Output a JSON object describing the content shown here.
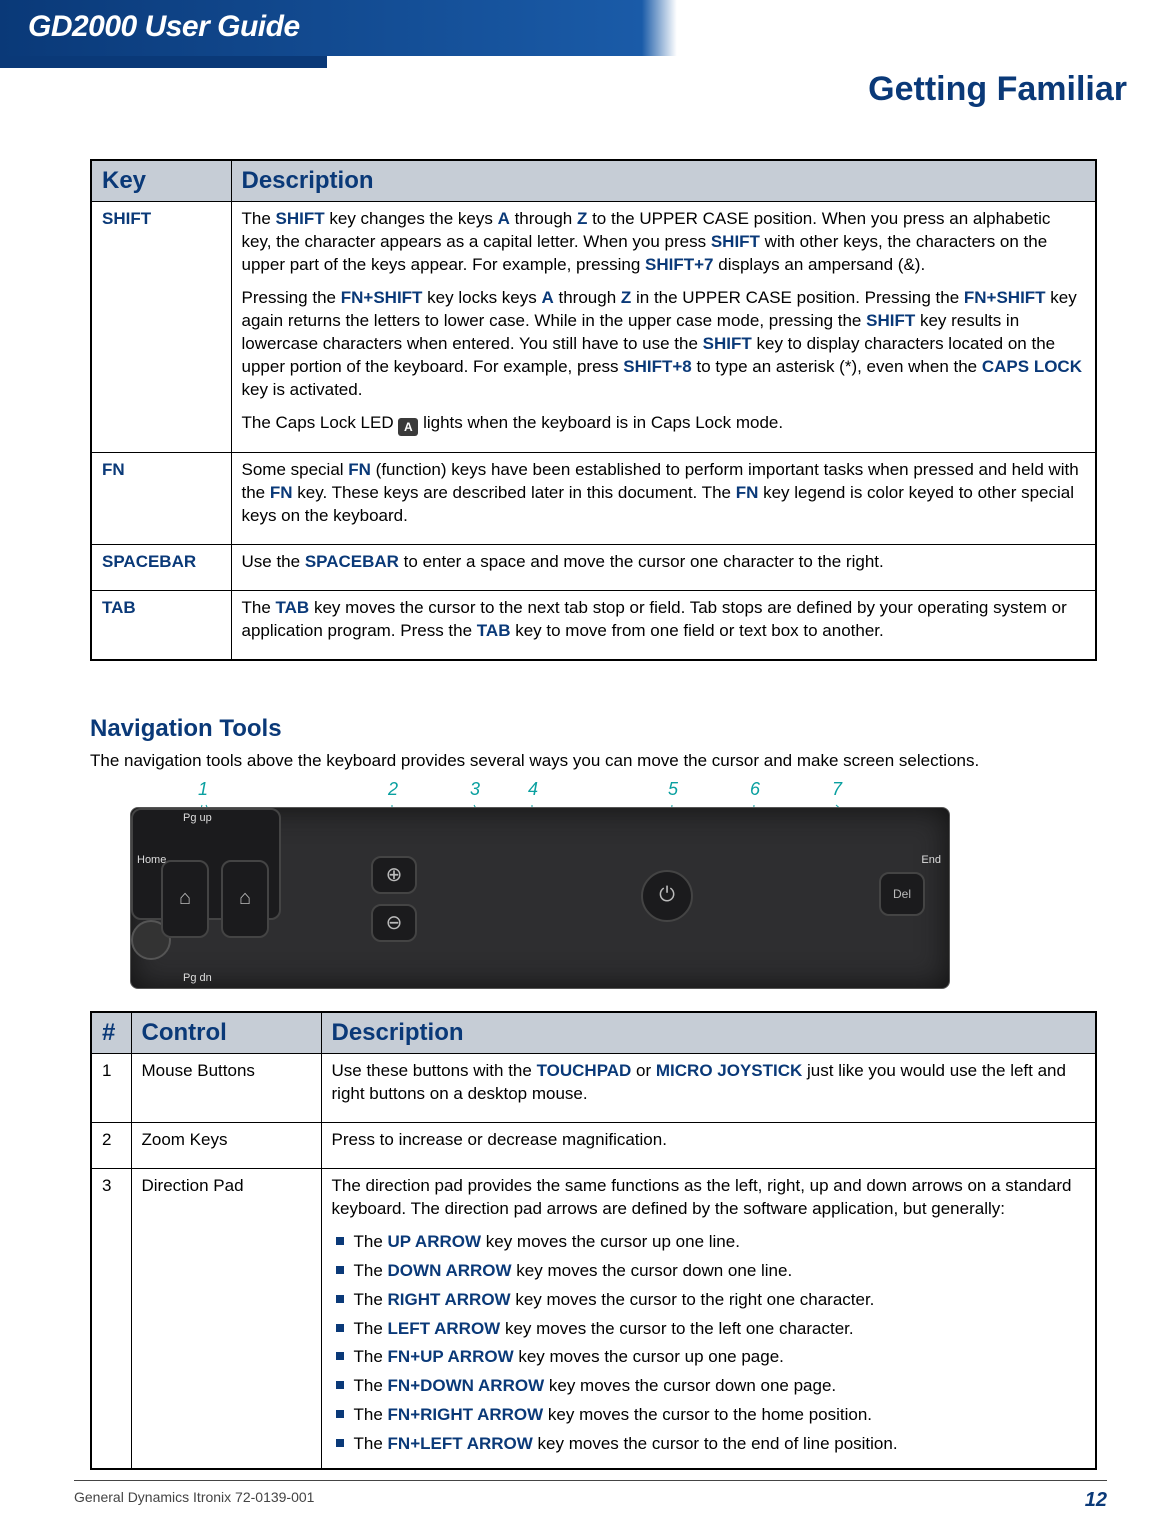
{
  "header": {
    "doc_title": "GD2000 User Guide",
    "section_title": "Getting Familiar"
  },
  "key_table": {
    "headers": {
      "key": "Key",
      "desc": "Description"
    },
    "rows": [
      {
        "key": "SHIFT",
        "paras": [
          "The <b>SHIFT</b> key changes the keys <b>A</b> through <b>Z</b> to the UPPER CASE position. When you press an alphabetic key, the character appears as a capital letter. When you press <b>SHIFT</b> with other keys, the characters on the upper part of the keys appear. For example, pressing <b>SHIFT+7</b> displays an ampersand (&).",
          "Pressing the <b>FN+SHIFT</b> key locks keys <b>A</b> through <b>Z</b> in the UPPER CASE position. Pressing the <b>FN+SHIFT</b> key again returns the letters to lower case. While in the upper case mode, pressing the <b>SHIFT</b> key results in lowercase characters when entered. You still have to use the <b>SHIFT</b> key to display characters located on the upper portion of the keyboard. For example, press <b>SHIFT+8</b> to type an asterisk (*), even when the <b>CAPS LOCK</b> key is activated.",
          "The Caps Lock LED <icon>A</icon> lights when the keyboard is in Caps Lock mode."
        ]
      },
      {
        "key": "FN",
        "paras": [
          "Some special <b>FN</b> (function) keys have been established to perform important tasks when pressed and held with the <b>FN</b> key. These keys are described later in this document.  The <b>FN</b> key legend is color keyed to other special keys on the keyboard."
        ]
      },
      {
        "key": "SPACEBAR",
        "paras": [
          "Use the <b>SPACEBAR</b> to enter a space and move the cursor one character to the right."
        ]
      },
      {
        "key": "TAB",
        "paras": [
          "The <b>TAB</b> key moves the cursor to the next tab stop or field. Tab stops are defined by your operating system or application program. Press the <b>TAB</b> key to move from one field or text box to another."
        ]
      }
    ]
  },
  "nav": {
    "heading": "Navigation Tools",
    "intro": "The navigation tools above the keyboard provides several ways you can move the cursor and make screen selections.",
    "callouts": [
      "1",
      "2",
      "3",
      "4",
      "5",
      "6",
      "7"
    ],
    "device": {
      "pgup": "Pg up",
      "pgdn": "Pg dn",
      "home": "Home",
      "end": "End",
      "del": "Del"
    }
  },
  "nav_table": {
    "headers": {
      "num": "#",
      "control": "Control",
      "desc": "Description"
    },
    "rows": [
      {
        "num": "1",
        "control": "Mouse Buttons",
        "desc_plain": "Use these buttons with the <b>TOUCHPAD</b> or <b>MICRO JOYSTICK</b> just like you would use the left and right buttons on a desktop mouse."
      },
      {
        "num": "2",
        "control": "Zoom Keys",
        "desc_plain": "Press to increase or decrease magnification."
      },
      {
        "num": "3",
        "control": "Direction Pad",
        "desc_plain": "The direction pad provides the same functions as the left, right, up and down arrows on a standard keyboard. The direction pad arrows are defined by the software application, but generally:",
        "bullets": [
          "The <b>UP ARROW</b> key moves the cursor up one line.",
          "The <b>DOWN ARROW</b> key moves the cursor down one line.",
          "The <b>RIGHT ARROW</b> key moves the cursor to the right one character.",
          "The <b>LEFT ARROW</b> key moves the cursor  to the left one character.",
          "The <b>FN+UP ARROW</b> key moves the cursor up one page.",
          "The <b>FN+DOWN ARROW</b> key moves the cursor down one page.",
          "The <b>FN+RIGHT ARROW</b> key moves the cursor to the home position.",
          "The <b>FN+LEFT ARROW</b> key moves the cursor  to the end of  line position."
        ]
      }
    ]
  },
  "footer": {
    "text": "General Dynamics Itronix 72-0139-001",
    "page": "12"
  }
}
